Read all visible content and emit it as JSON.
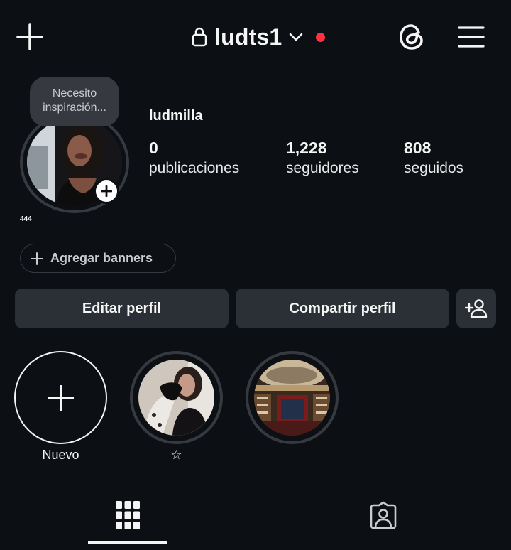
{
  "header": {
    "username": "ludts1",
    "icons": {
      "create": "plus-icon",
      "private": "lock-icon",
      "account_switch": "chevron-down-icon",
      "notification": "red-dot",
      "threads": "threads-icon",
      "menu": "hamburger-menu-icon"
    }
  },
  "profile": {
    "note": "Necesito inspiración...",
    "caption": "444",
    "display_name": "ludmilla",
    "stats": [
      {
        "value": "0",
        "label": "publicaciones"
      },
      {
        "value": "1,228",
        "label": "seguidores"
      },
      {
        "value": "808",
        "label": "seguidos"
      }
    ]
  },
  "banner_chip": {
    "label": "Agregar banners"
  },
  "actions": {
    "edit": "Editar perfil",
    "share": "Compartir perfil",
    "discover_icon": "add-person-icon"
  },
  "highlights": [
    {
      "label": "Nuevo",
      "type": "new"
    },
    {
      "label": "☆",
      "type": "story"
    },
    {
      "label": "",
      "type": "story"
    }
  ],
  "tabs": [
    {
      "name": "grid",
      "icon": "grid-icon",
      "active": true
    },
    {
      "name": "tagged",
      "icon": "tagged-person-icon",
      "active": false
    }
  ],
  "colors": {
    "background": "#0c1014",
    "button": "#2b3036",
    "ring": "#363a40",
    "notification": "#ff3040"
  }
}
